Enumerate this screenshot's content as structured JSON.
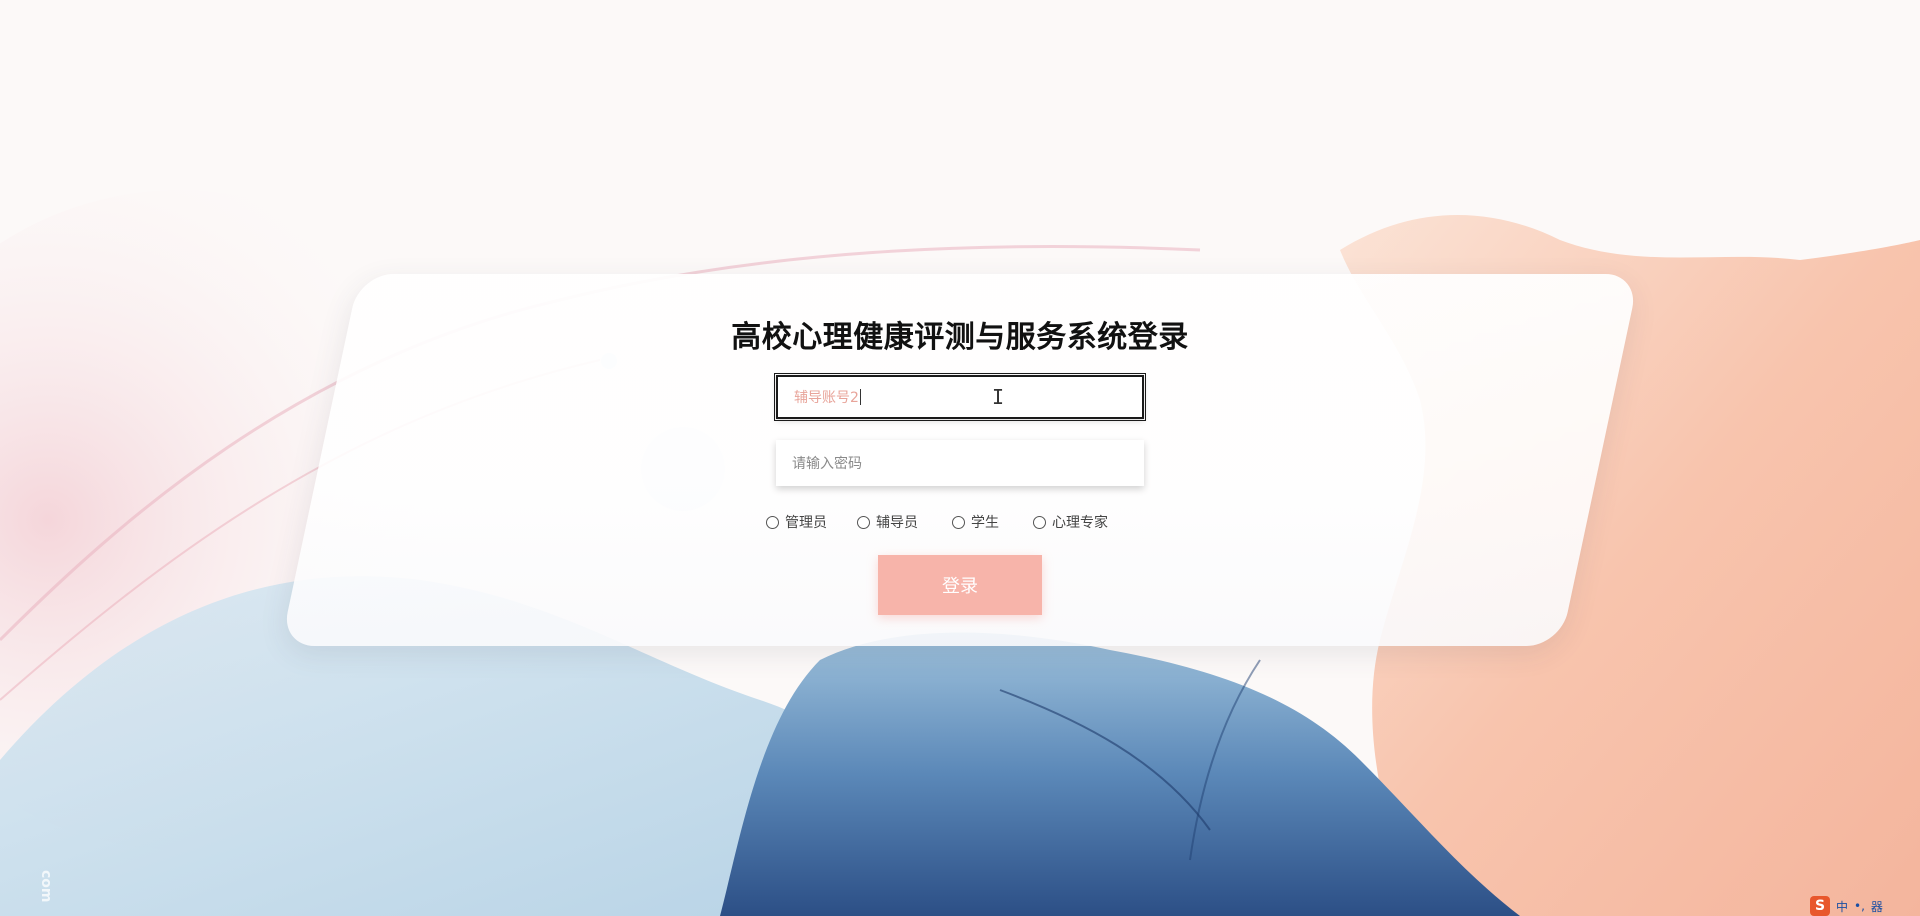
{
  "page": {
    "title": "高校心理健康评测与服务系统登录"
  },
  "form": {
    "account_value": "辅导账号2",
    "password_placeholder": "请输入密码",
    "roles": [
      {
        "label": "管理员"
      },
      {
        "label": "辅导员"
      },
      {
        "label": "学生"
      },
      {
        "label": "心理专家"
      }
    ],
    "login_label": "登录"
  },
  "watermark": {
    "text": "com"
  },
  "ime": {
    "logo": "S",
    "mode": "中",
    "symbols": "•,",
    "extra": "器"
  },
  "colors": {
    "accent": "#f7b4aa",
    "account_text": "#e8a49a",
    "title": "#111111"
  },
  "icons": {
    "text_cursor": "ibeam-cursor-icon",
    "radio": "radio-circle-icon",
    "ime_logo": "sogou-logo-icon"
  }
}
